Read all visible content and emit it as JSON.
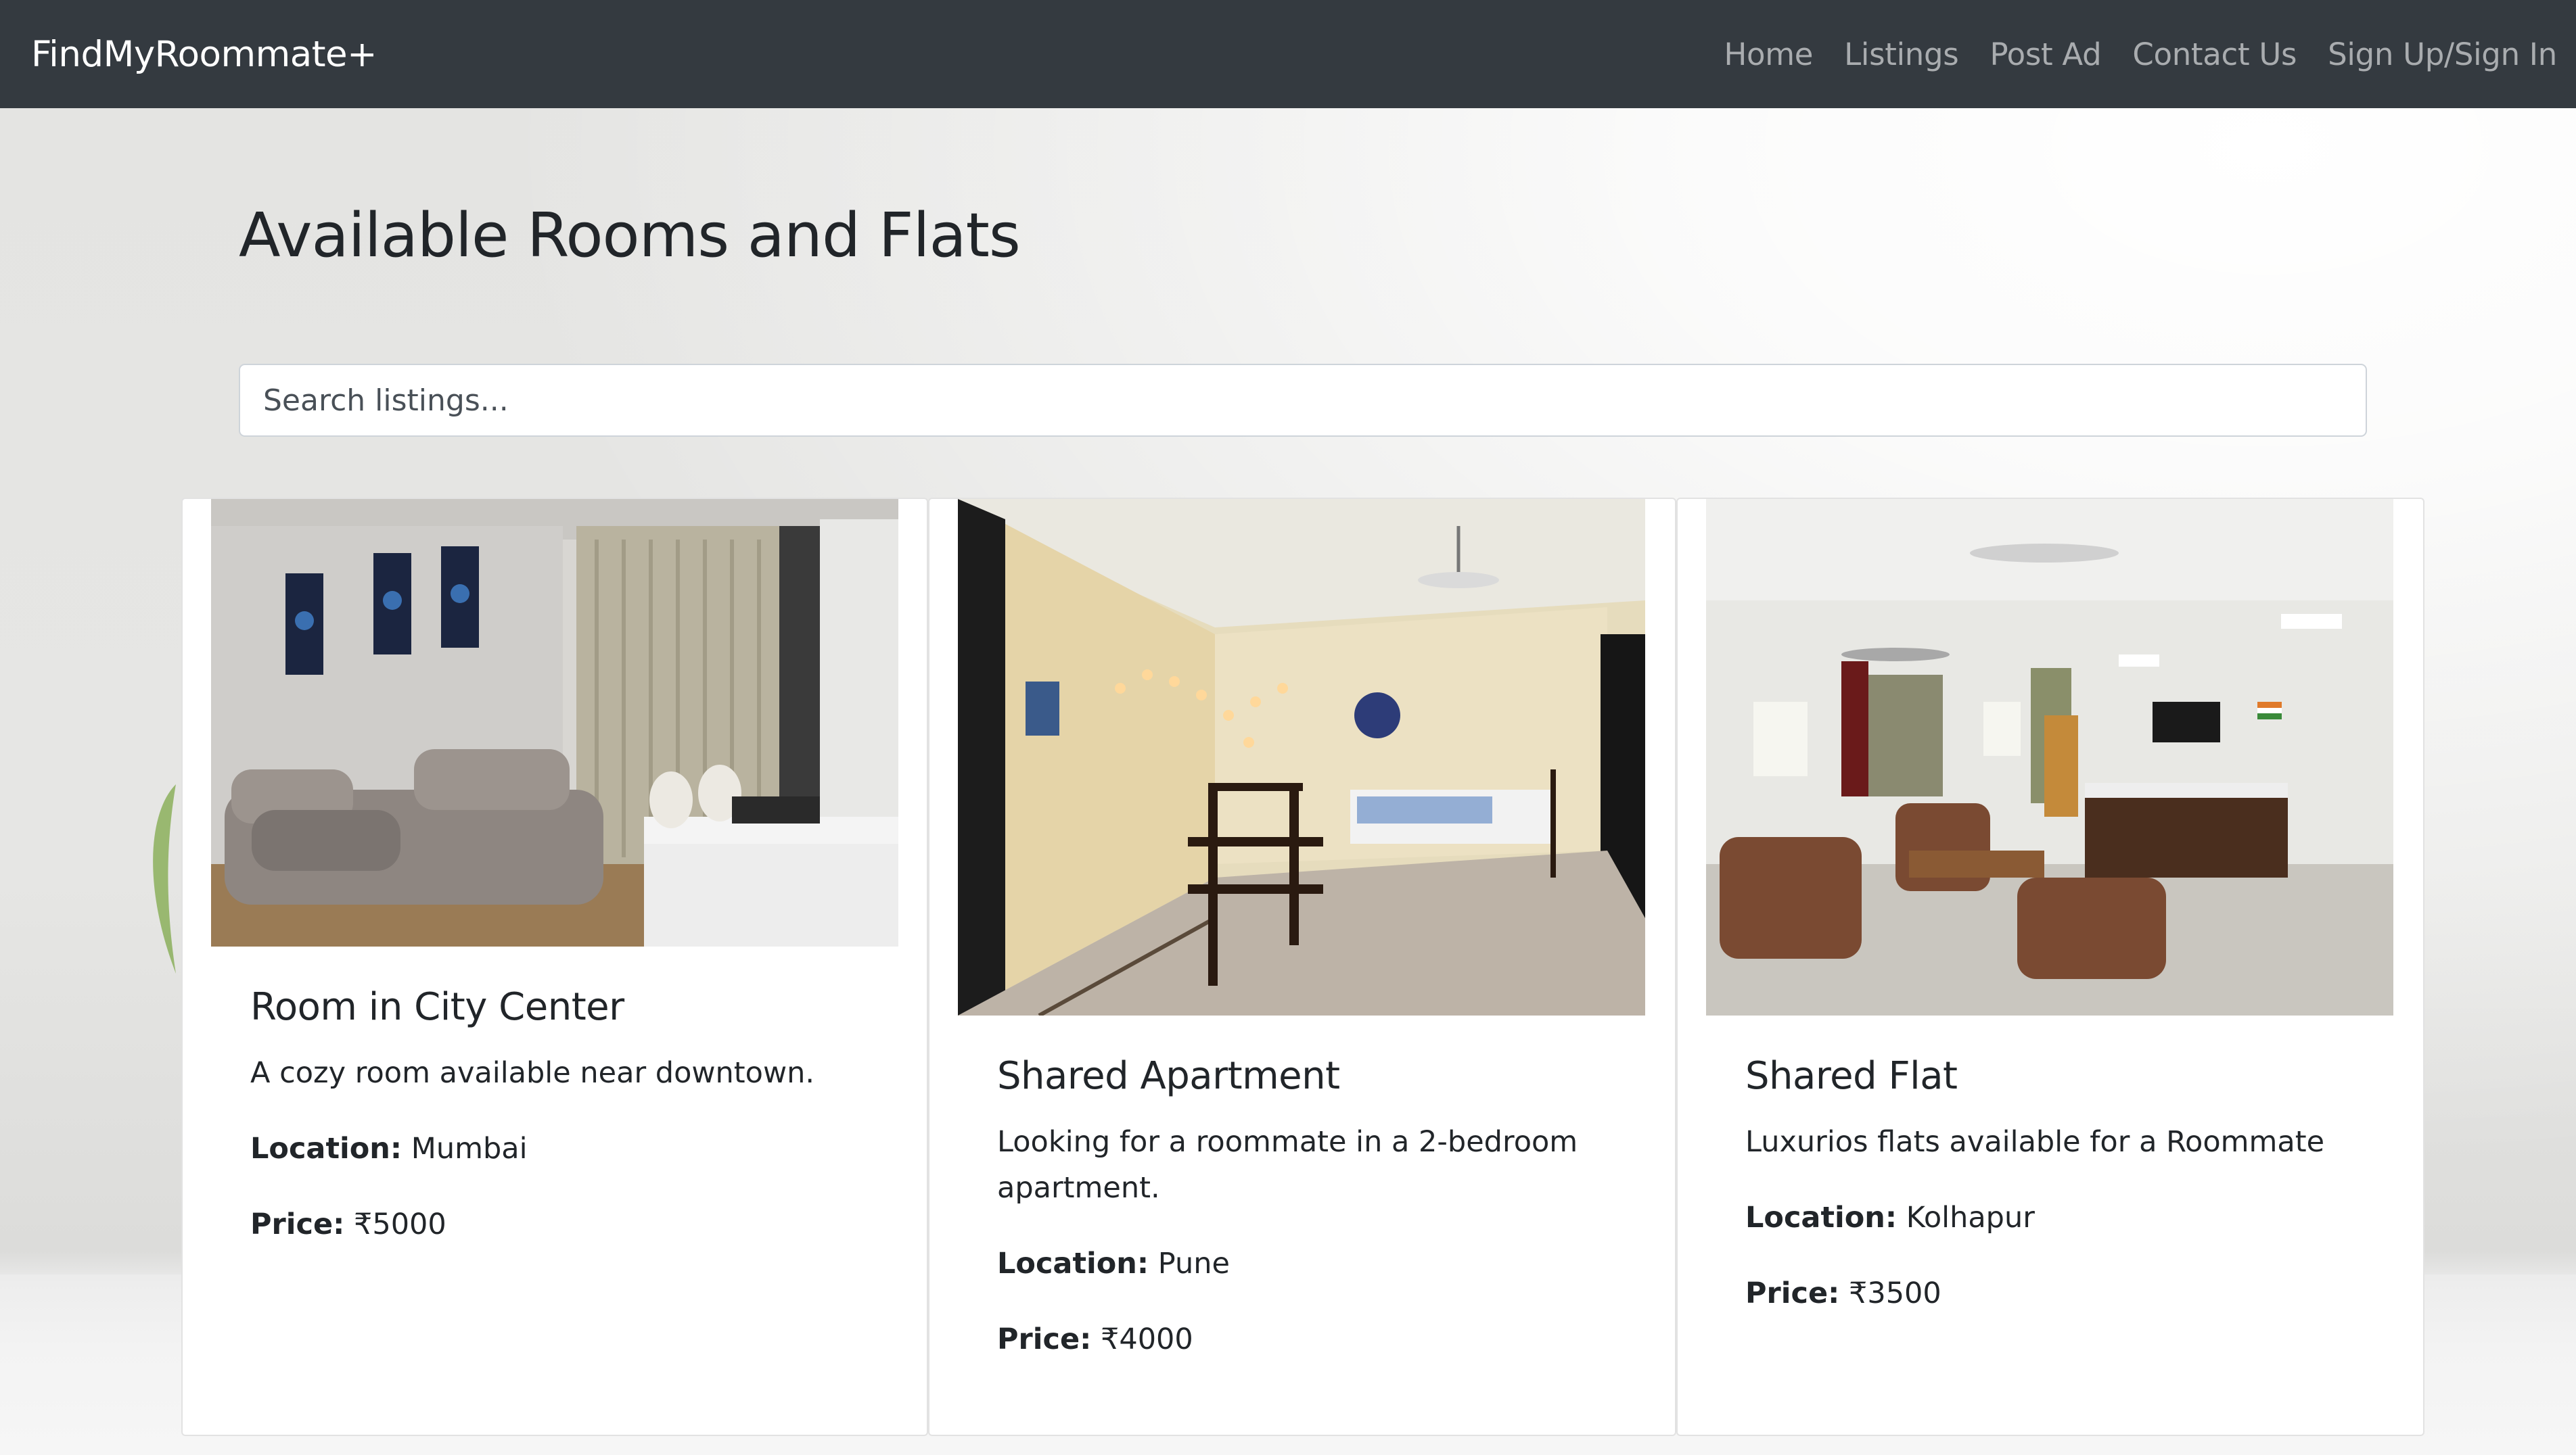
{
  "navbar": {
    "brand": "FindMyRoommate+",
    "links": [
      "Home",
      "Listings",
      "Post Ad",
      "Contact Us",
      "Sign Up/Sign In"
    ]
  },
  "page": {
    "title": "Available Rooms and Flats"
  },
  "search": {
    "placeholder": "Search listings..."
  },
  "listings": [
    {
      "title": "Room in City Center",
      "description": "A cozy room available near downtown.",
      "location_label": "Location:",
      "location": "Mumbai",
      "price_label": "Price:",
      "price": "₹5000"
    },
    {
      "title": "Shared Apartment",
      "description": "Looking for a roommate in a 2-bedroom apartment.",
      "location_label": "Location:",
      "location": "Pune",
      "price_label": "Price:",
      "price": "₹4000"
    },
    {
      "title": "Shared Flat",
      "description": "Luxurios flats available for a Roommate",
      "location_label": "Location:",
      "location": "Kolhapur",
      "price_label": "Price:",
      "price": "₹3500"
    }
  ],
  "colors": {
    "navbar_bg": "#343a40",
    "brand": "#ffffff",
    "nav_link": "#9a9da0",
    "text": "#212529"
  }
}
